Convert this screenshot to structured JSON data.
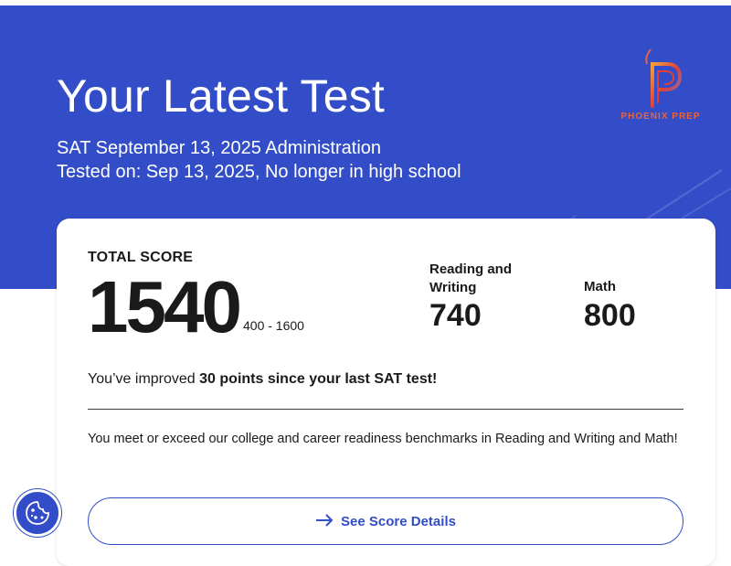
{
  "hero": {
    "title": "Your Latest Test",
    "administration": "SAT September 13, 2025 Administration",
    "tested_on": "Tested on: Sep 13, 2025, No longer in high school"
  },
  "logo": {
    "text": "PHOENIX PREP",
    "icon": "phoenix-p-logo"
  },
  "score": {
    "total_label": "TOTAL SCORE",
    "total": "1540",
    "range": "400 - 1600",
    "sections": [
      {
        "label": "Reading and Writing",
        "value": "740"
      },
      {
        "label": "Math",
        "value": "800"
      }
    ]
  },
  "improvement": {
    "prefix": "You’ve improved ",
    "highlight": "30 points since your last SAT test!"
  },
  "benchmark": "You meet or exceed our college and career readiness benchmarks in Reading and Writing and Math!",
  "details_button": {
    "label": "See Score Details",
    "icon": "arrow-right-icon"
  },
  "cookie_button": {
    "icon": "cookie-icon"
  },
  "colors": {
    "brand_blue": "#324dc7",
    "text": "#1a1a1a",
    "logo_accent": "#e8643c"
  }
}
